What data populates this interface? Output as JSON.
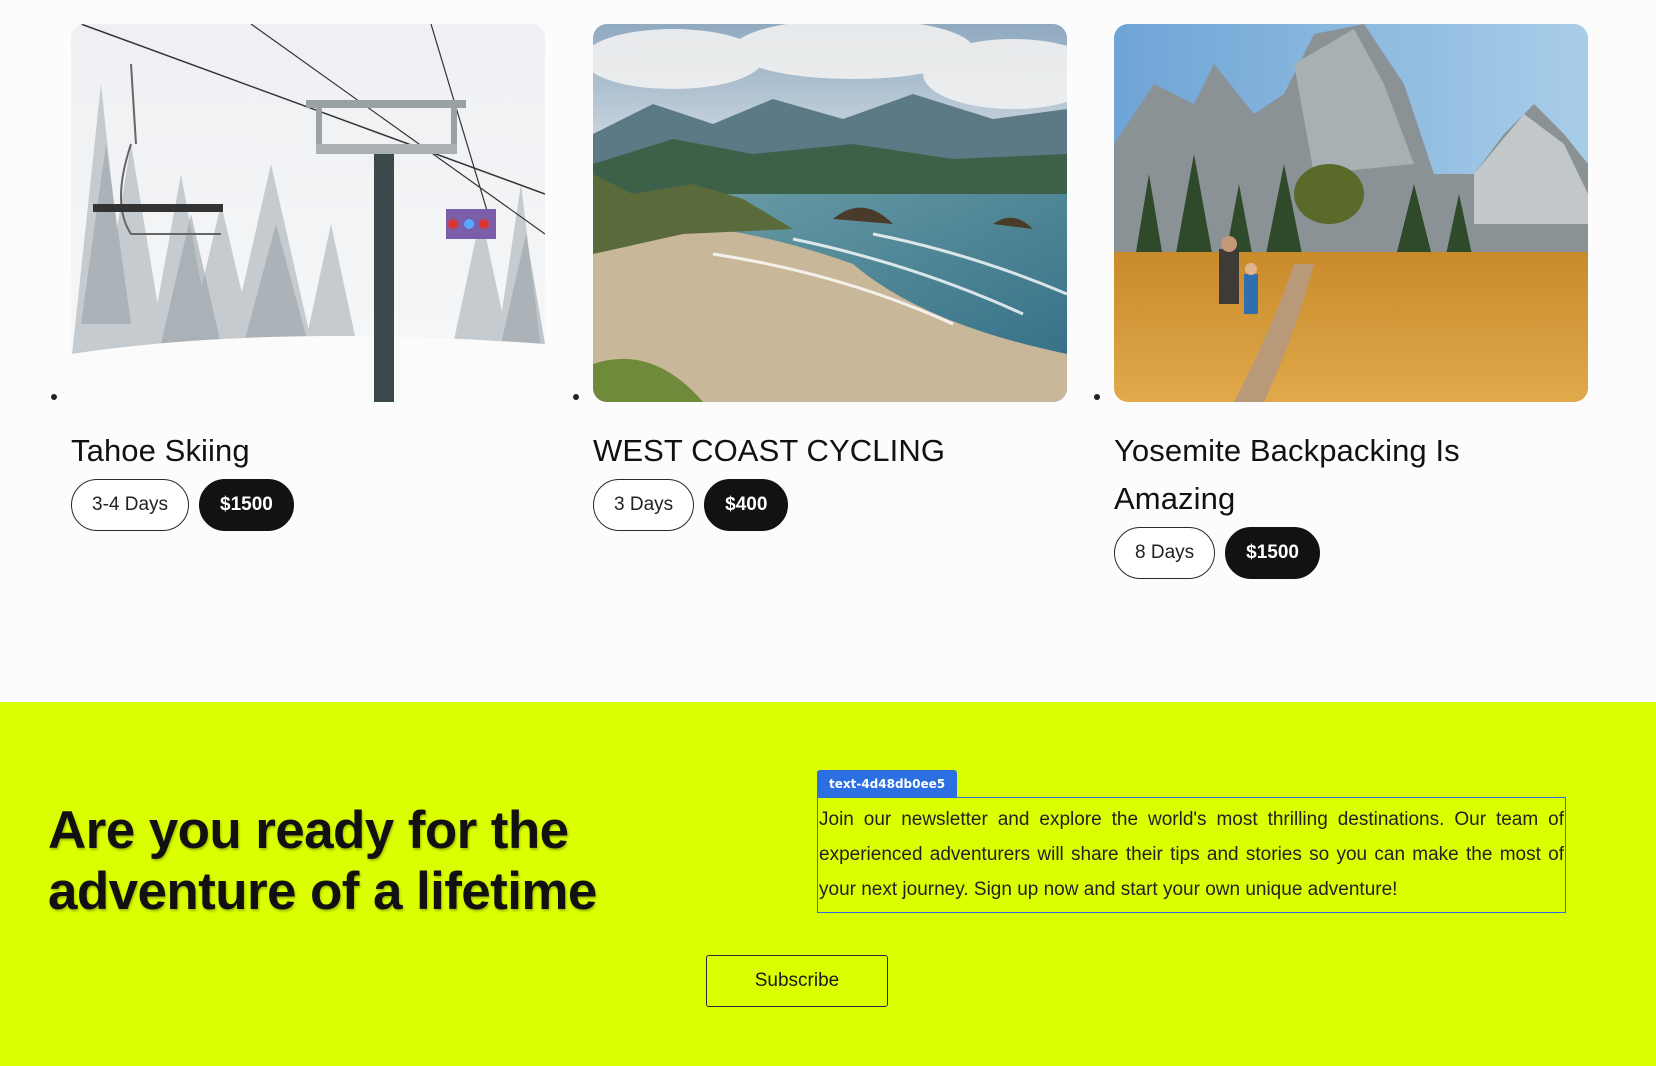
{
  "trips": [
    {
      "title": "Tahoe Skiing",
      "duration": "3-4 Days",
      "price": "$1500",
      "image": "ski-chairlift-snow-forest"
    },
    {
      "title": "WEST COAST CYCLING",
      "duration": "3 Days",
      "price": "$400",
      "image": "coastal-beach-mountains"
    },
    {
      "title": "Yosemite Backpacking Is Amazing",
      "duration": "8 Days",
      "price": "$1500",
      "image": "yosemite-meadow-hikers"
    }
  ],
  "newsletter": {
    "headline": "Are you ready for the adventure of a lifetime",
    "tag": "text-4d48db0ee5",
    "description": "Join our newsletter and explore the world's most thrilling destinations. Our team of experienced adventurers will share their tips and stories so you can make the most of your next journey. Sign up now and start your own unique adventure!",
    "subscribe_label": "Subscribe"
  },
  "colors": {
    "accent": "#dbff00",
    "dark": "#121212",
    "selection": "#2b6fe0"
  }
}
